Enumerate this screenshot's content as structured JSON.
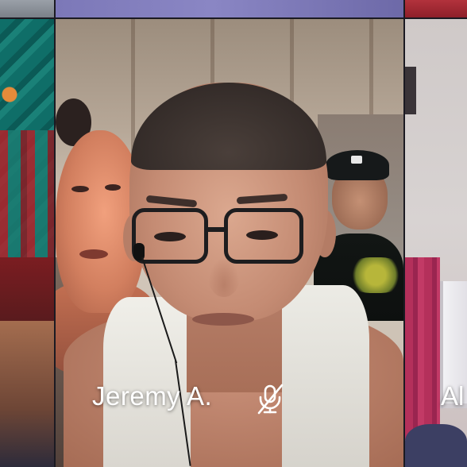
{
  "participants": {
    "main": {
      "name": "Jeremy A.",
      "mic_state": "muted",
      "mic_icon": "mic-off-icon"
    },
    "right": {
      "name_partial": "Al"
    }
  },
  "colors": {
    "name_text": "#ffffff",
    "top_mid_tile": "#7c78b8",
    "top_right_tile": "#b2323c"
  }
}
